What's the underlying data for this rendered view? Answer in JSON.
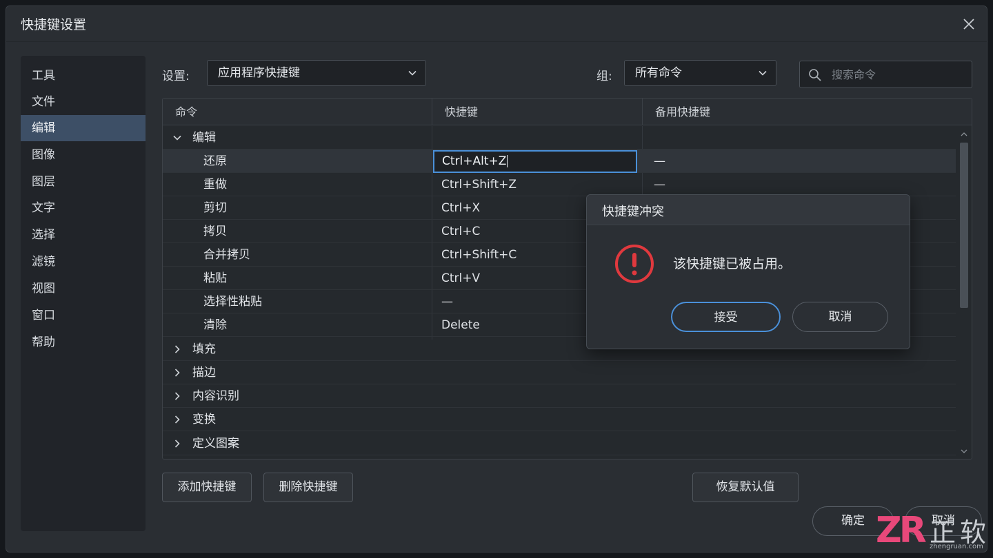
{
  "window": {
    "title": "快捷键设置"
  },
  "sidebar": {
    "items": [
      {
        "label": "工具"
      },
      {
        "label": "文件"
      },
      {
        "label": "编辑",
        "active": true
      },
      {
        "label": "图像"
      },
      {
        "label": "图层"
      },
      {
        "label": "文字"
      },
      {
        "label": "选择"
      },
      {
        "label": "滤镜"
      },
      {
        "label": "视图"
      },
      {
        "label": "窗口"
      },
      {
        "label": "帮助"
      }
    ]
  },
  "toolbar": {
    "settings_label": "设置:",
    "settings_value": "应用程序快捷键",
    "group_label": "组:",
    "group_value": "所有命令",
    "search_placeholder": "搜索命令"
  },
  "table": {
    "headers": {
      "command": "命令",
      "shortcut": "快捷键",
      "alt_shortcut": "备用快捷键"
    },
    "rows": [
      {
        "type": "group",
        "expanded": true,
        "label": "编辑"
      },
      {
        "type": "item",
        "label": "还原",
        "shortcut": "Ctrl+Alt+Z",
        "alt": "—",
        "editing": true
      },
      {
        "type": "item",
        "label": "重做",
        "shortcut": "Ctrl+Shift+Z",
        "alt": "—"
      },
      {
        "type": "item",
        "label": "剪切",
        "shortcut": "Ctrl+X",
        "alt": ""
      },
      {
        "type": "item",
        "label": "拷贝",
        "shortcut": "Ctrl+C",
        "alt": ""
      },
      {
        "type": "item",
        "label": "合并拷贝",
        "shortcut": "Ctrl+Shift+C",
        "alt": ""
      },
      {
        "type": "item",
        "label": "粘贴",
        "shortcut": "Ctrl+V",
        "alt": ""
      },
      {
        "type": "item",
        "label": "选择性粘贴",
        "shortcut": "—",
        "alt": ""
      },
      {
        "type": "item",
        "label": "清除",
        "shortcut": "Delete",
        "alt": ""
      },
      {
        "type": "group",
        "expanded": false,
        "label": "填充"
      },
      {
        "type": "group",
        "expanded": false,
        "label": "描边"
      },
      {
        "type": "group",
        "expanded": false,
        "label": "内容识别"
      },
      {
        "type": "group",
        "expanded": false,
        "label": "变换"
      },
      {
        "type": "group",
        "expanded": false,
        "label": "定义图案"
      }
    ]
  },
  "actions": {
    "add_shortcut": "添加快捷键",
    "delete_shortcut": "删除快捷键",
    "restore_defaults": "恢复默认值",
    "ok": "确定",
    "cancel": "取消"
  },
  "conflict_dialog": {
    "title": "快捷键冲突",
    "message": "该快捷键已被占用。",
    "accept": "接受",
    "cancel": "取消",
    "icon": "warning-icon"
  },
  "watermark": {
    "logo": "ZR",
    "name": "正软",
    "site": "zhengruan.com"
  },
  "colors": {
    "accent": "#4a90d9",
    "sidebar_active": "#3d4f66",
    "warning": "#e0393e",
    "watermark_pink": "#e8487a"
  }
}
